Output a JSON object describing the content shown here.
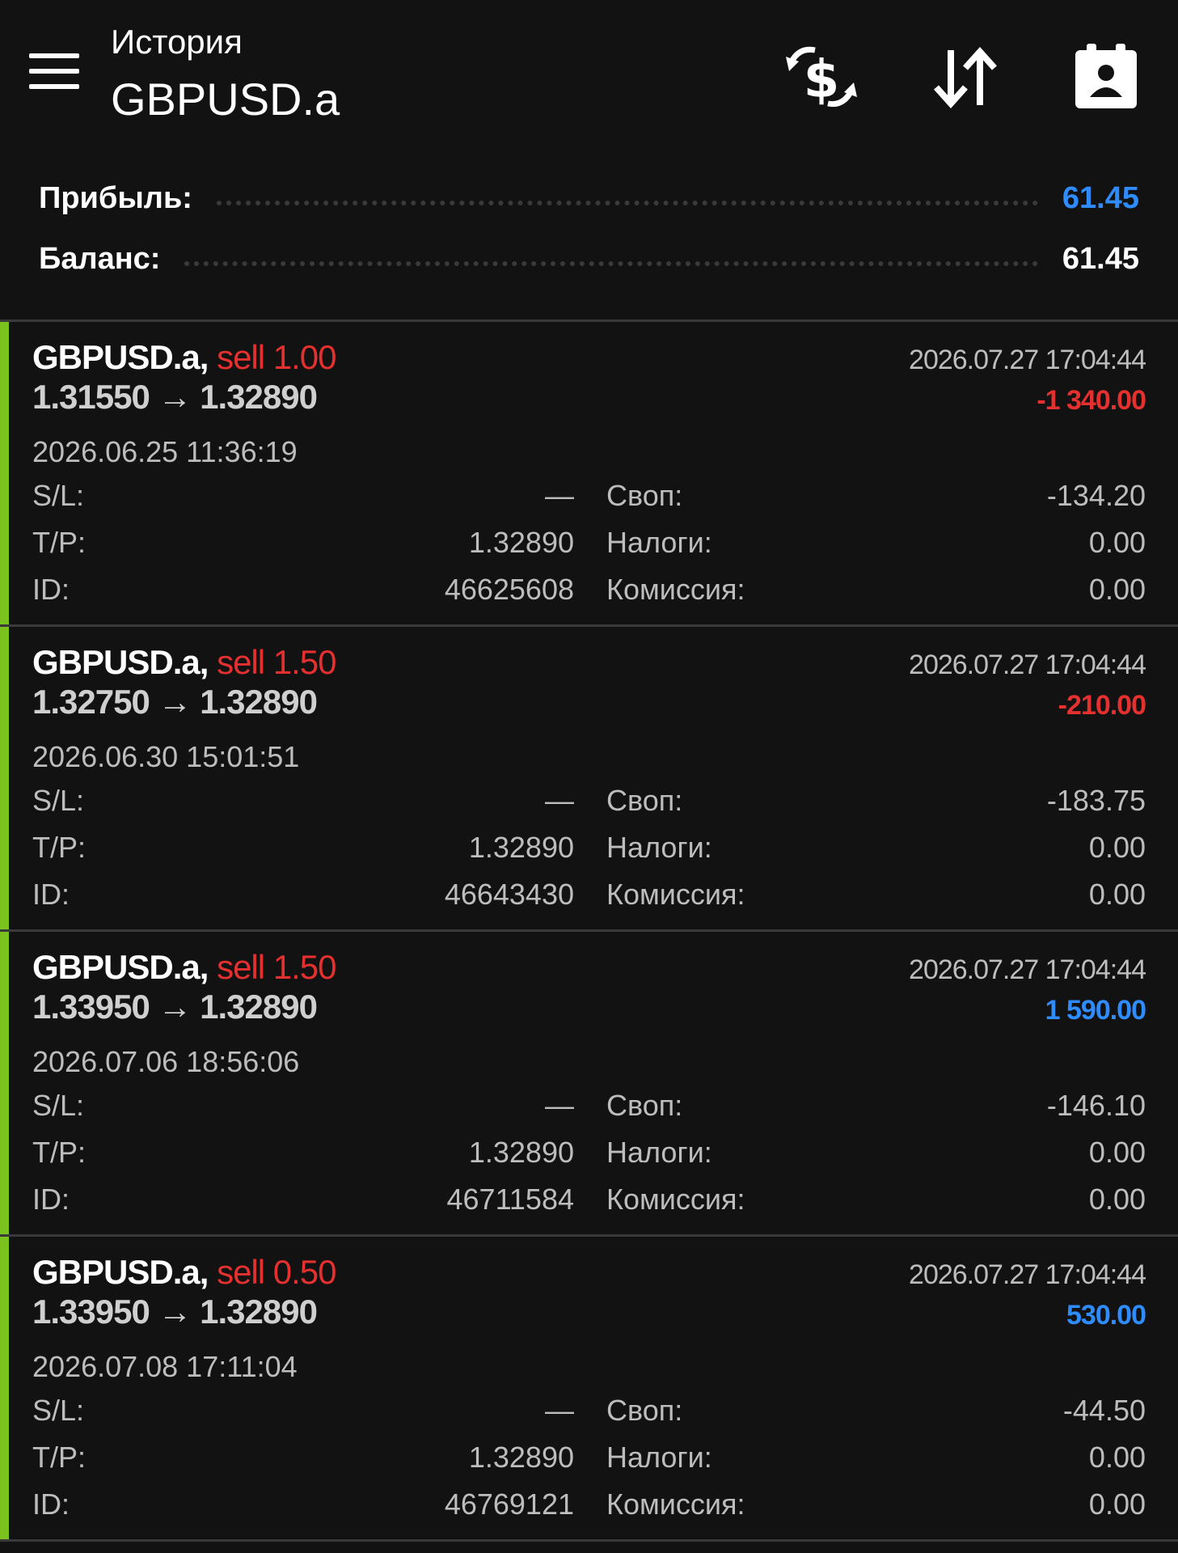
{
  "header": {
    "subtitle": "История",
    "title": "GBPUSD.a",
    "icons": [
      "menu-icon",
      "currency-exchange-icon",
      "sort-icon",
      "report-icon"
    ]
  },
  "summary": {
    "profit_label": "Прибыль:",
    "profit_value": "61.45",
    "balance_label": "Баланс:",
    "balance_value": "61.45"
  },
  "colors": {
    "accent_bar": "#7ac21d",
    "sell": "#e53030",
    "loss": "#e53030",
    "gain": "#2f8cff",
    "profit_summary": "#2f8cff"
  },
  "labels": {
    "sl": "S/L:",
    "tp": "T/P:",
    "id": "ID:",
    "swap": "Своп:",
    "taxes": "Налоги:",
    "commission": "Комиссия:"
  },
  "deals": [
    {
      "symbol": "GBPUSD.a,",
      "side": "sell 1.00",
      "prices": "1.31550 → 1.32890",
      "close_time": "2026.07.27 17:04:44",
      "profit": "-1 340.00",
      "profit_type": "loss",
      "open_time": "2026.06.25 11:36:19",
      "sl": "—",
      "tp": "1.32890",
      "id": "46625608",
      "swap": "-134.20",
      "taxes": "0.00",
      "commission": "0.00"
    },
    {
      "symbol": "GBPUSD.a,",
      "side": "sell 1.50",
      "prices": "1.32750 → 1.32890",
      "close_time": "2026.07.27 17:04:44",
      "profit": "-210.00",
      "profit_type": "loss",
      "open_time": "2026.06.30 15:01:51",
      "sl": "—",
      "tp": "1.32890",
      "id": "46643430",
      "swap": "-183.75",
      "taxes": "0.00",
      "commission": "0.00"
    },
    {
      "symbol": "GBPUSD.a,",
      "side": "sell 1.50",
      "prices": "1.33950 → 1.32890",
      "close_time": "2026.07.27 17:04:44",
      "profit": "1 590.00",
      "profit_type": "gain",
      "open_time": "2026.07.06 18:56:06",
      "sl": "—",
      "tp": "1.32890",
      "id": "46711584",
      "swap": "-146.10",
      "taxes": "0.00",
      "commission": "0.00"
    },
    {
      "symbol": "GBPUSD.a,",
      "side": "sell 0.50",
      "prices": "1.33950 → 1.32890",
      "close_time": "2026.07.27 17:04:44",
      "profit": "530.00",
      "profit_type": "gain",
      "open_time": "2026.07.08 17:11:04",
      "sl": "—",
      "tp": "1.32890",
      "id": "46769121",
      "swap": "-44.50",
      "taxes": "0.00",
      "commission": "0.00"
    }
  ]
}
